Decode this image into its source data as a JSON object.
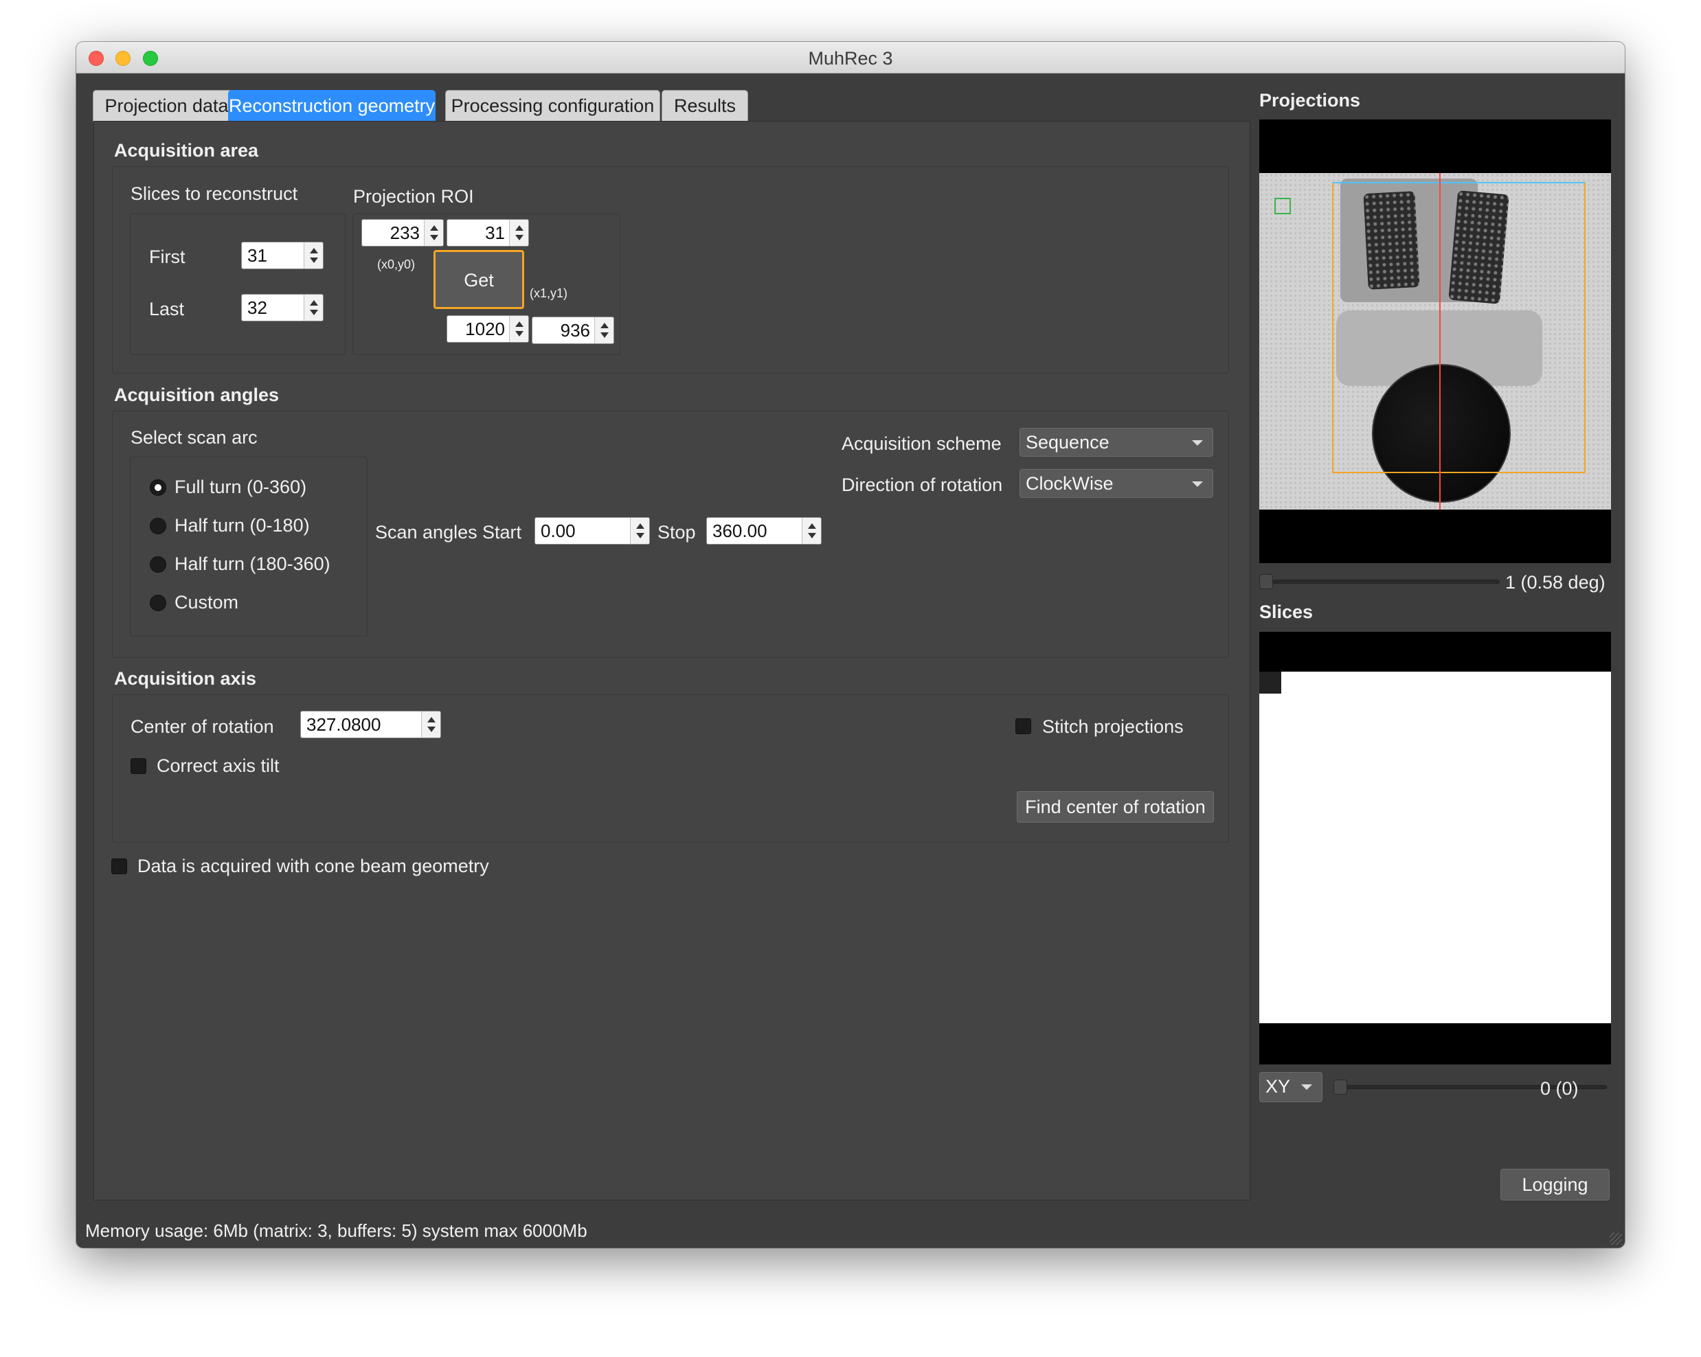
{
  "window": {
    "title": "MuhRec 3"
  },
  "tabs": [
    {
      "label": "Projection data",
      "active": false
    },
    {
      "label": "Reconstruction geometry",
      "active": true
    },
    {
      "label": "Processing configuration",
      "active": false
    },
    {
      "label": "Results",
      "active": false
    }
  ],
  "acquisition_area": {
    "title": "Acquisition area",
    "slices": {
      "label": "Slices to reconstruct",
      "first_label": "First",
      "first_value": "31",
      "last_label": "Last",
      "last_value": "32"
    },
    "roi": {
      "label": "Projection ROI",
      "x0": "233",
      "y0": "31",
      "x0y0_label": "(x0,y0)",
      "get_label": "Get",
      "x1y1_label": "(x1,y1)",
      "x1": "1020",
      "y1": "936"
    }
  },
  "acquisition_angles": {
    "title": "Acquisition angles",
    "scan_arc_label": "Select scan arc",
    "options": [
      {
        "label": "Full turn (0-360)",
        "checked": true
      },
      {
        "label": "Half turn (0-180)",
        "checked": false
      },
      {
        "label": "Half turn (180-360)",
        "checked": false
      },
      {
        "label": "Custom",
        "checked": false
      }
    ],
    "scan_angles_label": "Scan angles",
    "start_label": "Start",
    "start_value": "0.00",
    "stop_label": "Stop",
    "stop_value": "360.00",
    "scheme_label": "Acquisition scheme",
    "scheme_value": "Sequence",
    "direction_label": "Direction of rotation",
    "direction_value": "ClockWise"
  },
  "acquisition_axis": {
    "title": "Acquisition axis",
    "center_label": "Center of rotation",
    "center_value": "327.0800",
    "correct_tilt_label": "Correct axis tilt",
    "correct_tilt_checked": false,
    "stitch_label": "Stitch projections",
    "stitch_checked": false,
    "find_center_label": "Find center of rotation"
  },
  "cone_beam": {
    "label": "Data is acquired with cone beam geometry",
    "checked": false
  },
  "right_panel": {
    "projections_title": "Projections",
    "projection_index_label": "1 (0.58 deg)",
    "projection_slider_fraction": 0,
    "slices_title": "Slices",
    "plane_value": "XY",
    "slice_index_label": "0 (0)",
    "slice_slider_fraction": 0,
    "logging_label": "Logging"
  },
  "status_bar": {
    "text": "Memory usage: 6Mb (matrix: 3, buffers: 5) system max 6000Mb"
  },
  "colors": {
    "window_bg": "#3d3d3d",
    "panel_bg": "#444444",
    "active_tab": "#2d8dfb",
    "roi_highlight": "#f5a623",
    "roi_box": "#f5a623",
    "roi_box_top": "#4fc3f7",
    "center_line": "#ff4444"
  }
}
